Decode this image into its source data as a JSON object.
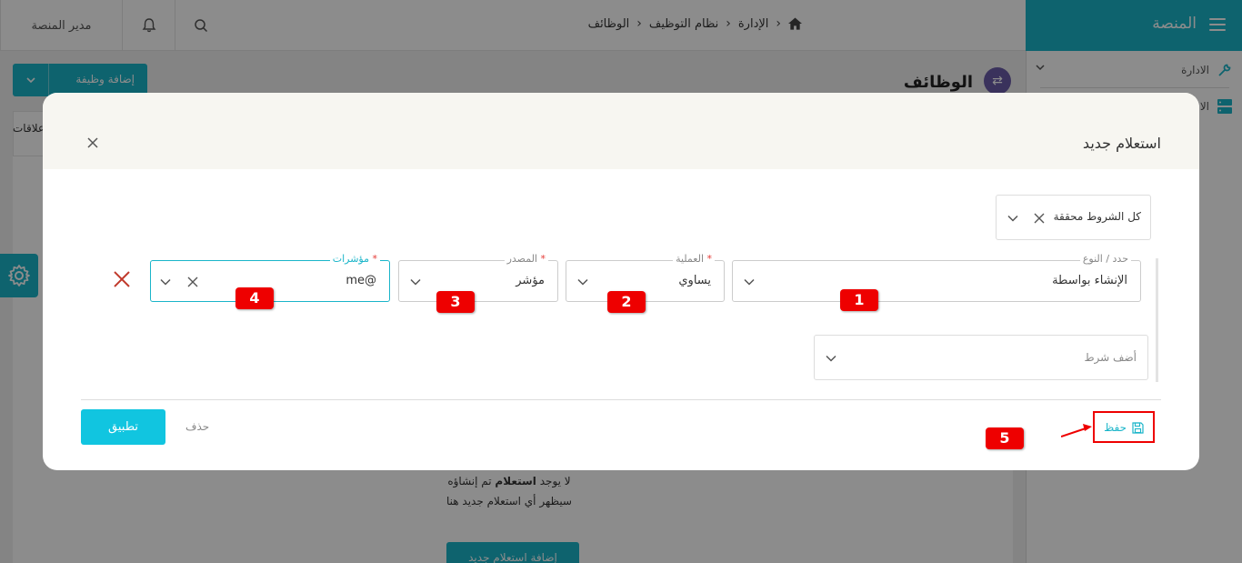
{
  "app": {
    "brand": "المنصة",
    "breadcrumb": [
      "الإدارة",
      "نظام التوظيف",
      "الوظائف"
    ],
    "user_label": "مدير المنصة",
    "accent": "#1ab5c9"
  },
  "sidebar": {
    "items": [
      {
        "label": "الادارة",
        "icon": "wrench-icon"
      },
      {
        "label": "الا",
        "icon": "server-icon"
      }
    ]
  },
  "page": {
    "title": "الوظائف",
    "add_job_label": "إضافة وظيفة",
    "tab_relations": "علاقات",
    "empty_line1_pre": "لا يوجد ",
    "empty_line1_bold": "استعلام",
    "empty_line1_post": " تم إنشاؤه",
    "empty_line2": "سيظهر أي استعلام جديد هنا",
    "new_query_label": "إضافة استعلام جديد"
  },
  "modal": {
    "title": "استعلام جديد",
    "condition_mode": "كل الشروط محققة",
    "fields": {
      "type": {
        "label": "حدد / النوع",
        "value": "الإنشاء بواسطة",
        "required": false
      },
      "operation": {
        "label": "العملية",
        "value": "يساوي",
        "required": true
      },
      "source": {
        "label": "المصدر",
        "value": "مؤشر",
        "required": true
      },
      "indicators": {
        "label": "مؤشرات",
        "value": "@me",
        "required": true
      }
    },
    "add_condition_placeholder": "أضف شرط",
    "save_label": "حفظ",
    "delete_label": "حذف",
    "apply_label": "تطبيق",
    "required_mark": "*"
  },
  "annotations": {
    "badges": [
      "1",
      "2",
      "3",
      "4",
      "5"
    ],
    "color": "#e00000"
  }
}
